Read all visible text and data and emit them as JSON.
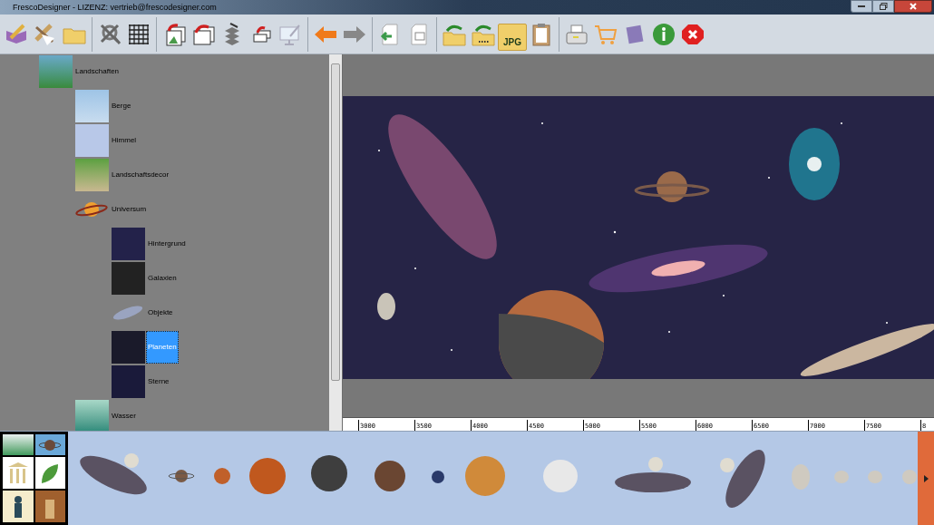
{
  "window": {
    "title": "FrescoDesigner - LIZENZ: vertrieb@frescodesigner.com"
  },
  "toolbar": {
    "jpg_label": "JPG"
  },
  "tree": [
    {
      "label": "Landschaften",
      "selected": false,
      "children": [
        {
          "label": "Berge",
          "selected": false
        },
        {
          "label": "Himmel",
          "selected": false
        },
        {
          "label": "Landschaftsdecor",
          "selected": false
        },
        {
          "label": "Universum",
          "selected": false,
          "children": [
            {
              "label": "Hintergrund",
              "selected": false
            },
            {
              "label": "Galaxien",
              "selected": false
            },
            {
              "label": "Objekte",
              "selected": false
            },
            {
              "label": "Planeten",
              "selected": true
            },
            {
              "label": "Sterne",
              "selected": false
            }
          ]
        },
        {
          "label": "Wasser",
          "selected": false
        }
      ]
    }
  ],
  "ruler": {
    "labels": [
      "3000",
      "3500",
      "4000",
      "4500",
      "5000",
      "5500",
      "6000",
      "6500",
      "7000",
      "7500",
      "8"
    ]
  }
}
